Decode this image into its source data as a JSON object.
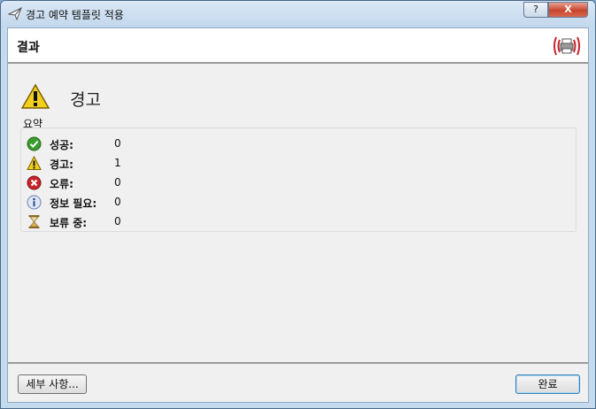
{
  "window": {
    "title": "경고 예약 템플릿 적용",
    "help_label": "?",
    "close_label": "X"
  },
  "header": {
    "title": "결과"
  },
  "status": {
    "text": "경고"
  },
  "summary": {
    "label": "요약",
    "rows": [
      {
        "label": "성공:",
        "value": "0",
        "icon": "success-check-icon"
      },
      {
        "label": "경고:",
        "value": "1",
        "icon": "warning-icon"
      },
      {
        "label": "오류:",
        "value": "0",
        "icon": "error-icon"
      },
      {
        "label": "정보 필요:",
        "value": "0",
        "icon": "info-icon"
      },
      {
        "label": "보류 중:",
        "value": "0",
        "icon": "hourglass-icon"
      }
    ]
  },
  "buttons": {
    "details": "세부 사항...",
    "ok": "완료"
  },
  "colors": {
    "success": "#3a9b2f",
    "warning": "#f2cf1e",
    "error": "#c9232b",
    "info": "#6a7fb6",
    "close": "#c8452d"
  }
}
